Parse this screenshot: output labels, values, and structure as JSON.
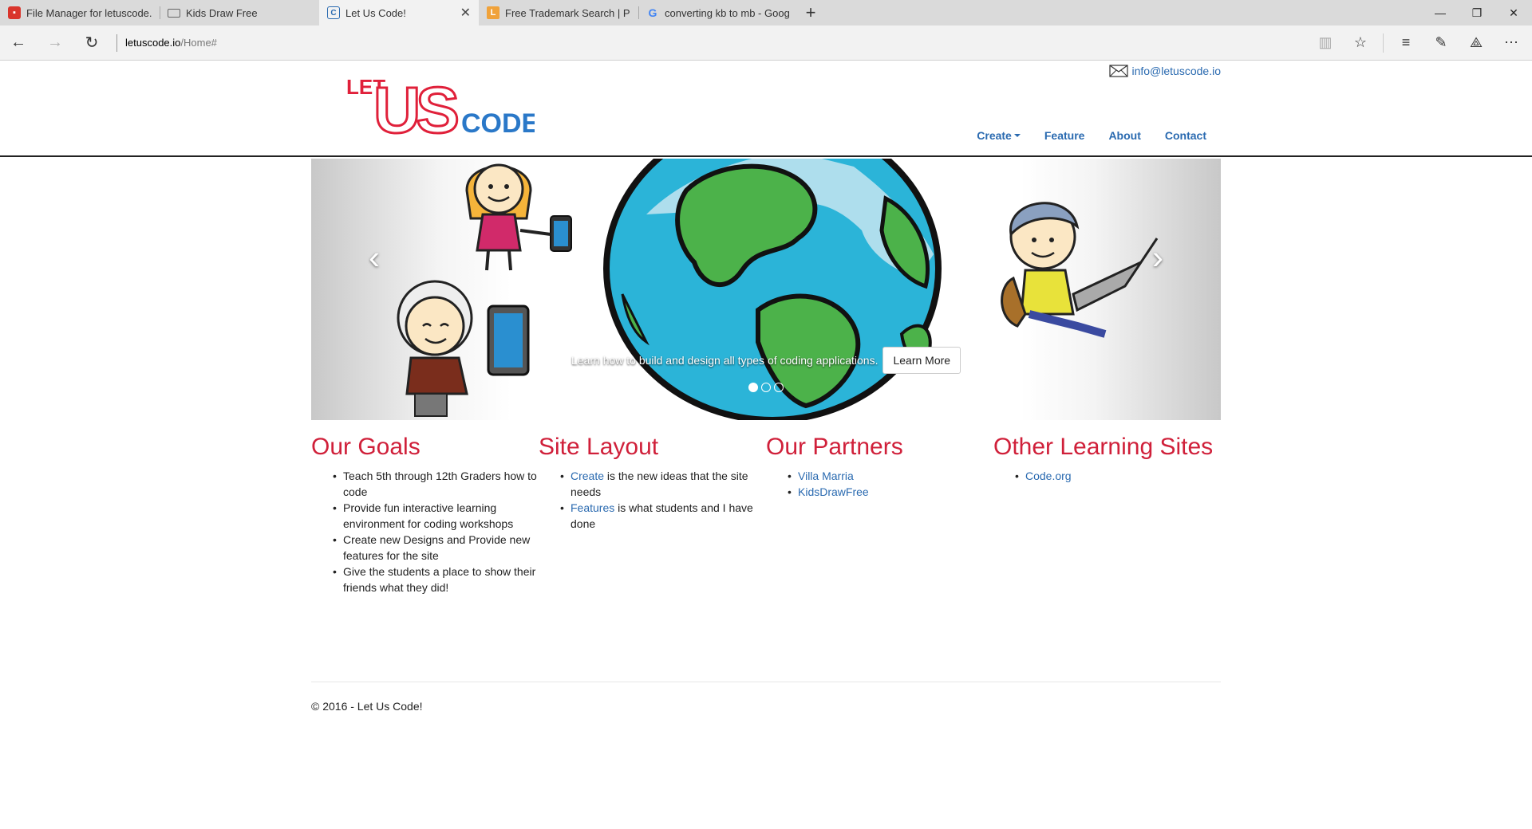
{
  "browser": {
    "tabs": [
      {
        "title": "File Manager for letuscode.",
        "icon": "file-manager-icon",
        "active": false
      },
      {
        "title": "Kids Draw Free",
        "icon": "page-icon",
        "active": false
      },
      {
        "title": "Let Us Code!",
        "icon": "letuscode-icon",
        "active": true,
        "close": "✕"
      },
      {
        "title": "Free Trademark Search | Prc",
        "icon": "trademark-icon",
        "active": false
      },
      {
        "title": "converting kb to mb - Goog",
        "icon": "google-icon",
        "active": false
      }
    ],
    "url_host": "letuscode.io",
    "url_path": "/Home#"
  },
  "site": {
    "logo_text": {
      "let": "LET",
      "us": "US",
      "code": "CODE"
    },
    "email": "info@letuscode.io",
    "nav": [
      {
        "label": "Create"
      },
      {
        "label": "Feature"
      },
      {
        "label": "About"
      },
      {
        "label": "Contact"
      }
    ],
    "carousel": {
      "caption": "Learn how to build and design all types of coding applications.",
      "button": "Learn More",
      "prev": "‹",
      "next": "›",
      "active_slide": 1,
      "slide_count": 3
    },
    "sections": {
      "goals": {
        "title": "Our Goals",
        "items": [
          "Teach 5th through 12th Graders how to code",
          "Provide fun interactive learning environment for coding workshops",
          "Create new Designs and Provide new features for the site",
          "Give the students a place to show their friends what they did!"
        ]
      },
      "layout": {
        "title": "Site Layout",
        "items": [
          {
            "link": "Create",
            "text": " is the new ideas that the site needs"
          },
          {
            "link": "Features",
            "text": " is what students and I have done"
          }
        ]
      },
      "partners": {
        "title": "Our Partners",
        "items": [
          "Villa Marria",
          "KidsDrawFree"
        ]
      },
      "other": {
        "title": "Other Learning Sites",
        "items": [
          "Code.org"
        ]
      }
    },
    "footer": "© 2016 - Let Us Code!"
  },
  "colors": {
    "link": "#2a6ab0",
    "heading": "#d0203a",
    "logo_red": "#e0203a",
    "logo_blue": "#2a78c8"
  }
}
